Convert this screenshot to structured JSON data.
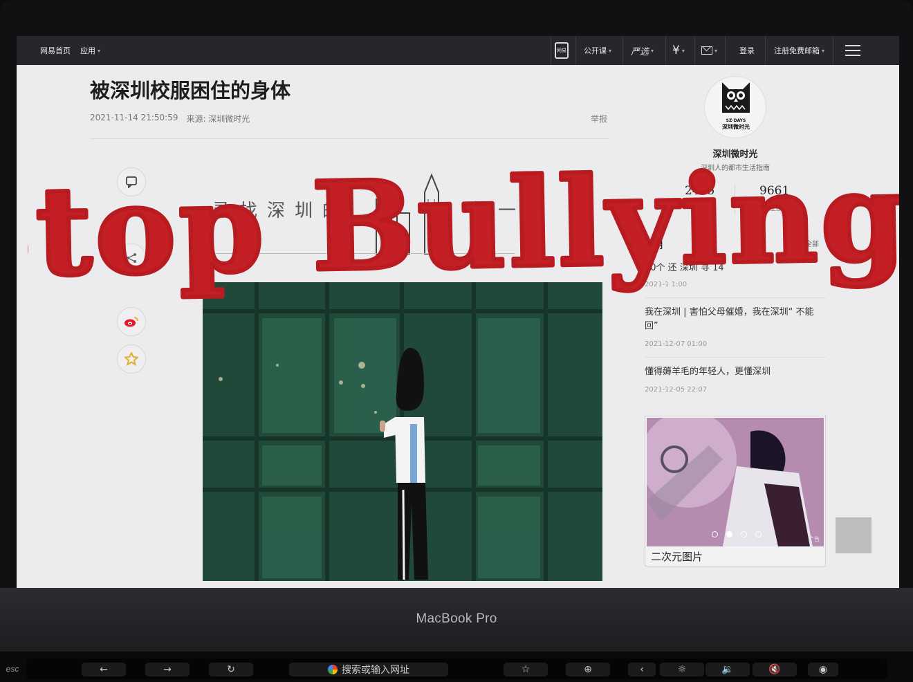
{
  "topbar": {
    "home": "网易首页",
    "apps": "应用",
    "phone_icon_label": "网易",
    "open_course": "公开课",
    "yanxuan": "严选",
    "currency": "¥",
    "login": "登录",
    "register": "注册免费邮箱"
  },
  "article": {
    "title": "被深圳校服困住的身体",
    "datetime": "2021-11-14 21:50:59",
    "source": "来源: 深圳微时光",
    "report": "举报",
    "banner_left": "寻找深圳的",
    "banner_right": "每一寸"
  },
  "author": {
    "logo_top": "SZ·DAYS",
    "logo_text": "深圳微时光",
    "name": "深圳微时光",
    "tagline": "深圳人的都市生活指南",
    "articles_count": "2495",
    "articles_label": "文章",
    "followers_count": "9661",
    "followers_label": "关注度"
  },
  "past": {
    "heading": "往期",
    "all": "全部",
    "items": [
      {
        "title": "40个        还      深圳     寻   14",
        "date": "2021-1      1:00"
      },
      {
        "title": "我在深圳 | 害怕父母催婚，我在深圳“    不能回”",
        "date": "2021-12-07 01:00"
      },
      {
        "title": "懂得薅羊毛的年轻人，更懂深圳",
        "date": "2021-12-05 22:07"
      }
    ]
  },
  "ad": {
    "caption": "二次元图片",
    "label": "广告"
  },
  "overlay": {
    "headline": "Stop Bullying!",
    "color": "#c41f24"
  },
  "laptop": {
    "brand": "MacBook Pro",
    "esc": "esc",
    "touchbar_search": "搜索或输入网址"
  }
}
